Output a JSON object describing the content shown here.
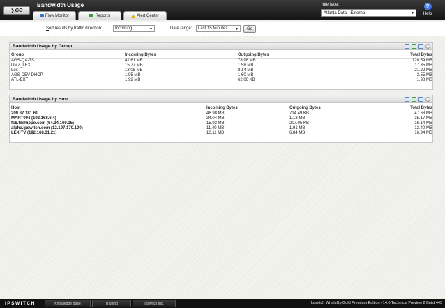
{
  "header": {
    "go_label": "GO",
    "title": "Bandwidth Usage",
    "tabs": [
      {
        "label": "Flow Monitor"
      },
      {
        "label": "Reports"
      },
      {
        "label": "Alert Center"
      }
    ],
    "interface_label": "Interface:",
    "interface_value": "Atlanta Data - External",
    "help_label": "Help"
  },
  "filters": {
    "sort_prefix": "S",
    "sort_label_rest": "ort results by traffic direction:",
    "sort_value": "Incoming",
    "date_label": "Date range:",
    "date_value": "Last 15 Minutes",
    "go_button": "Go"
  },
  "group_panel": {
    "title": "Bandwidth Usage by Group",
    "columns": [
      "Group",
      "Incoming Bytes",
      "Outgoing Bytes",
      "Total Bytes"
    ],
    "rows": [
      [
        "AGS-QA-TS",
        "41.61 MB",
        "78.98 MB",
        "120.59 MB"
      ],
      [
        "DMZ_LEX",
        "15.77 MB",
        "1.58 MB",
        "17.35 MB"
      ],
      [
        "Lex",
        "13.08 MB",
        "8.14 MB",
        "21.22 MB"
      ],
      [
        "AGS-DEV-DHCP",
        "1.95 MB",
        "1.60 MB",
        "3.55 MB"
      ],
      [
        "ATL-EXT",
        "1.92 MB",
        "62.06 KB",
        "1.98 MB"
      ]
    ]
  },
  "host_panel": {
    "title": "Bandwidth Usage by Host",
    "columns": [
      "Host",
      "Incoming Bytes",
      "Outgoing Bytes",
      "Total Bytes"
    ],
    "rows": [
      [
        "209.87.181.61",
        "46.98 MB",
        "714.49 KB",
        "47.68 MB"
      ],
      [
        "MART004 (192.168.6.4)",
        "34.04 MB",
        "1.13 MB",
        "35.17 MB"
      ],
      [
        "fs6.filehippo.com (64.34.169.15)",
        "15.93 MB",
        "207.05 KB",
        "16.14 MB"
      ],
      [
        "alpha.ipswitch.com (12.197.170.100)",
        "11.49 MB",
        "1.91 MB",
        "13.40 MB"
      ],
      [
        "LEX-TV (192.168.31.21)",
        "10.11 MB",
        "6.84 MB",
        "16.94 MB"
      ]
    ]
  },
  "footer": {
    "brand": "IPSWITCH",
    "links": [
      "Knowledge Base",
      "Training",
      "Ipswitch Inc."
    ],
    "version": "Ipswitch WhatsUp Gold Premium Edition v14.0 Technical Preview 2 Build 443"
  }
}
